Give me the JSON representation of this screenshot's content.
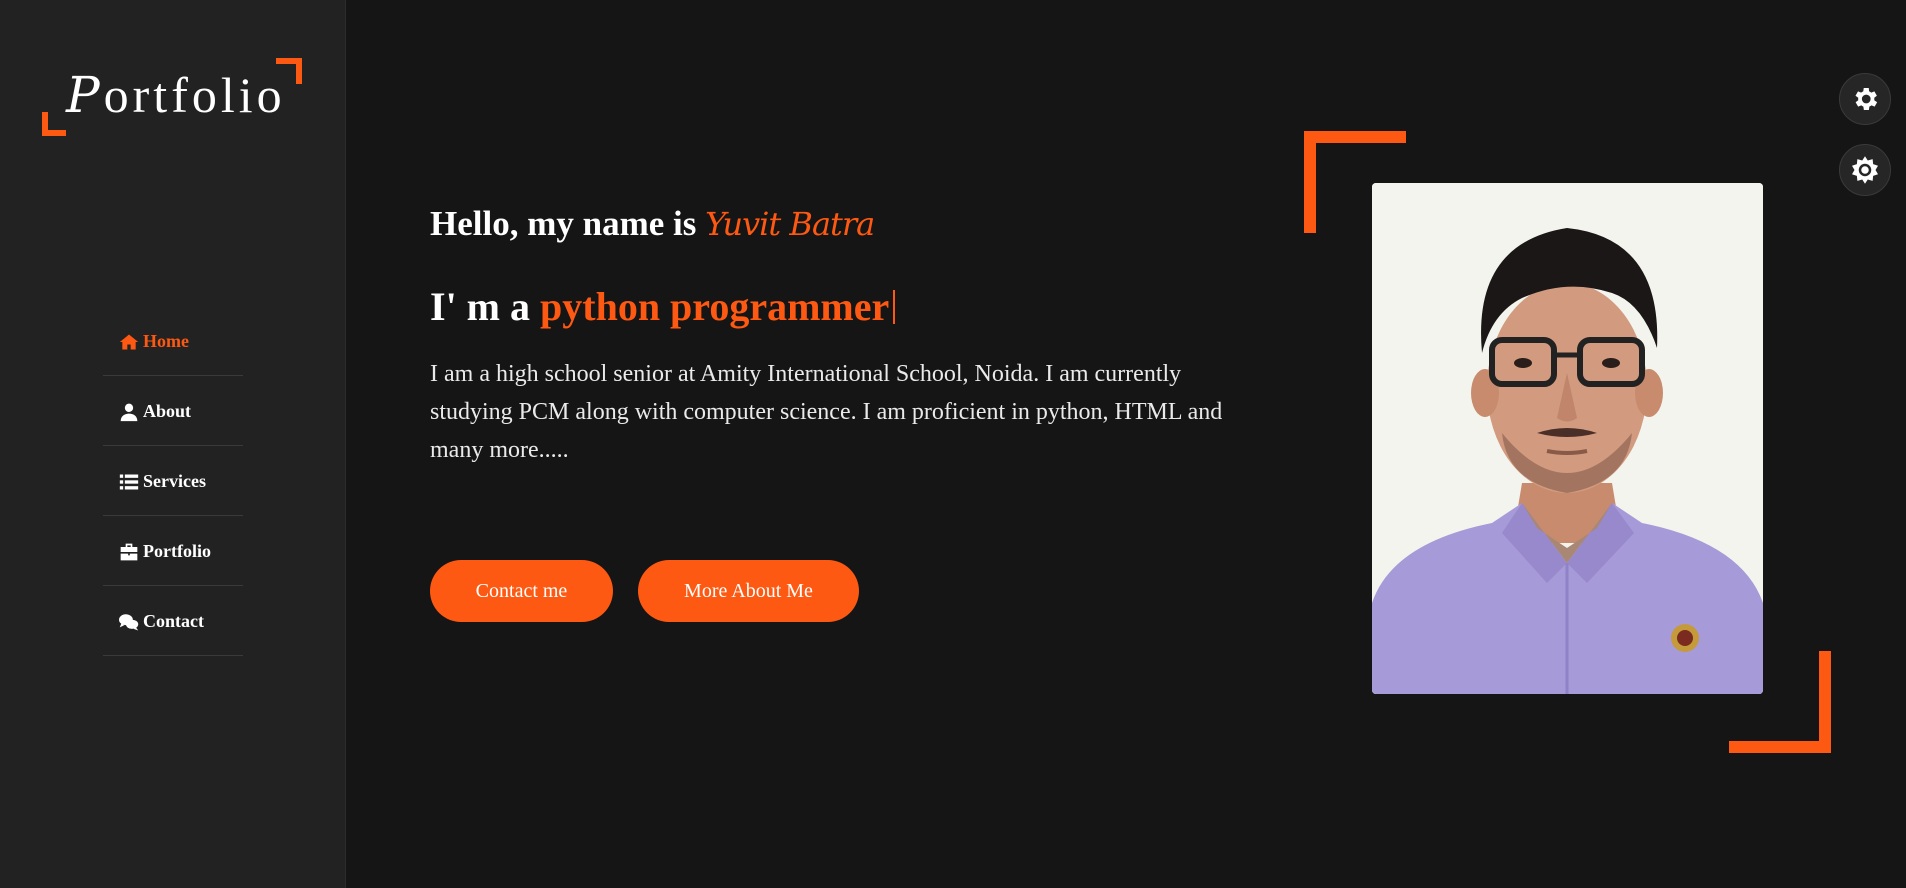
{
  "sidebar": {
    "logo_first": "P",
    "logo_rest": "ortfolio",
    "items": [
      {
        "label": "Home",
        "icon": "home-icon"
      },
      {
        "label": "About",
        "icon": "user-icon"
      },
      {
        "label": "Services",
        "icon": "list-icon"
      },
      {
        "label": "Portfolio",
        "icon": "briefcase-icon"
      },
      {
        "label": "Contact",
        "icon": "chat-icon"
      }
    ],
    "active_index": 0
  },
  "hero": {
    "greeting": "Hello, my name is",
    "name": "Yuvit Batra",
    "role_prefix": "I' m a",
    "role": "python programmer",
    "bio": "I am a high school senior at Amity International School, Noida. I am currently studying PCM along with computer science. I am proficient in python, HTML and many more.....",
    "buttons": {
      "contact": "Contact me",
      "about": "More About Me"
    }
  },
  "profile_photo": "portrait of Yuvit Batra",
  "settings": {
    "icons": [
      "gear-icon",
      "sun-icon"
    ]
  },
  "colors": {
    "accent": "#fd5912",
    "background": "#151515",
    "sidebar": "#222222"
  }
}
